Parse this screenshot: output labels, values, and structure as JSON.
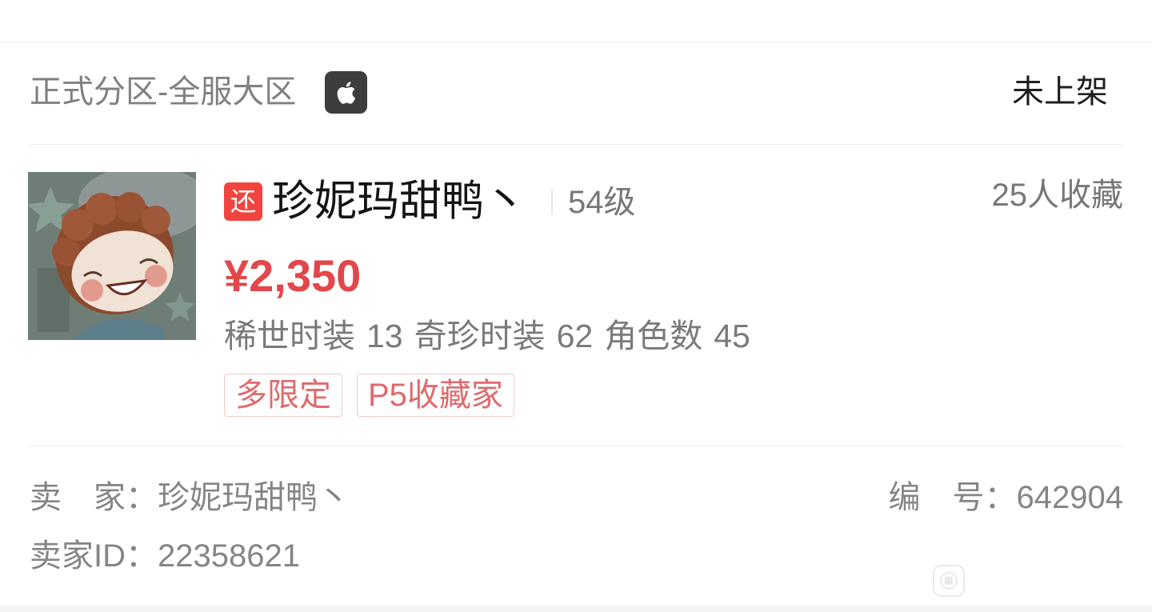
{
  "header": {
    "server": "正式分区-全服大区",
    "platform_icon": "apple-icon",
    "status": "未上架"
  },
  "item": {
    "badge": "还",
    "name": "珍妮玛甜鸭丶",
    "level": "54级",
    "favorites": "25人收藏",
    "price": "¥2,350",
    "stats": [
      {
        "label": "稀世时装",
        "value": "13"
      },
      {
        "label": "奇珍时装",
        "value": "62"
      },
      {
        "label": "角色数",
        "value": "45"
      }
    ],
    "tags": [
      "多限定",
      "P5收藏家"
    ]
  },
  "seller": {
    "name_label": "卖　家：",
    "name": "珍妮玛甜鸭丶",
    "serial_label": "编　号：",
    "serial": "642904",
    "id_label": "卖家ID：",
    "id": "22358621"
  },
  "watermark_icon": "watermark-icon",
  "colors": {
    "price": "#e2474b",
    "badge": "#f2443f",
    "tag_text": "#e06a6c",
    "tag_border": "#f1c7c7",
    "muted_text": "#808080",
    "primary_text": "#141414",
    "platform_icon_bg": "#3d3d3d"
  }
}
